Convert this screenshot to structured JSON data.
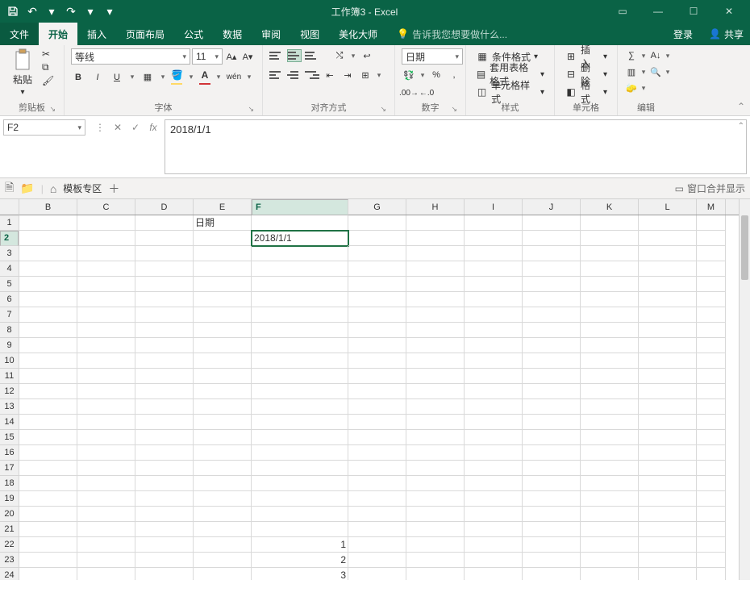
{
  "title": "工作簿3 - Excel",
  "menu": {
    "file": "文件",
    "home": "开始",
    "insert": "插入",
    "layout": "页面布局",
    "formulas": "公式",
    "data": "数据",
    "review": "审阅",
    "view": "视图",
    "beautify": "美化大师",
    "tellme": "告诉我您想要做什么...",
    "signin": "登录",
    "share": "共享"
  },
  "ribbon": {
    "clipboard": {
      "label": "剪贴板",
      "paste": "粘贴"
    },
    "font": {
      "label": "字体",
      "name": "等线",
      "size": "11",
      "bold": "B",
      "italic": "I",
      "underline": "U",
      "phonetic": "wén"
    },
    "align": {
      "label": "对齐方式"
    },
    "number": {
      "label": "数字",
      "format": "日期",
      "percent": "%"
    },
    "styles": {
      "label": "样式",
      "cond": "条件格式",
      "table": "套用表格格式",
      "cell": "单元格样式"
    },
    "cells": {
      "label": "单元格",
      "insert": "插入",
      "delete": "删除",
      "format": "格式"
    },
    "editing": {
      "label": "编辑"
    }
  },
  "namebox": "F2",
  "formula": "2018/1/1",
  "secbar": {
    "tpl": "模板专区",
    "merge": "窗口合并显示"
  },
  "cols": [
    "B",
    "C",
    "D",
    "E",
    "F",
    "G",
    "H",
    "I",
    "J",
    "K",
    "L",
    "M"
  ],
  "widths": [
    72,
    72,
    72,
    72,
    120,
    72,
    72,
    72,
    72,
    72,
    72,
    36
  ],
  "rows": 24,
  "cells": {
    "E1": "日期",
    "F2": "2018/1/1",
    "F22": "1",
    "F23": "2",
    "F24": "3"
  },
  "selected": {
    "row": 2,
    "col": "F"
  }
}
